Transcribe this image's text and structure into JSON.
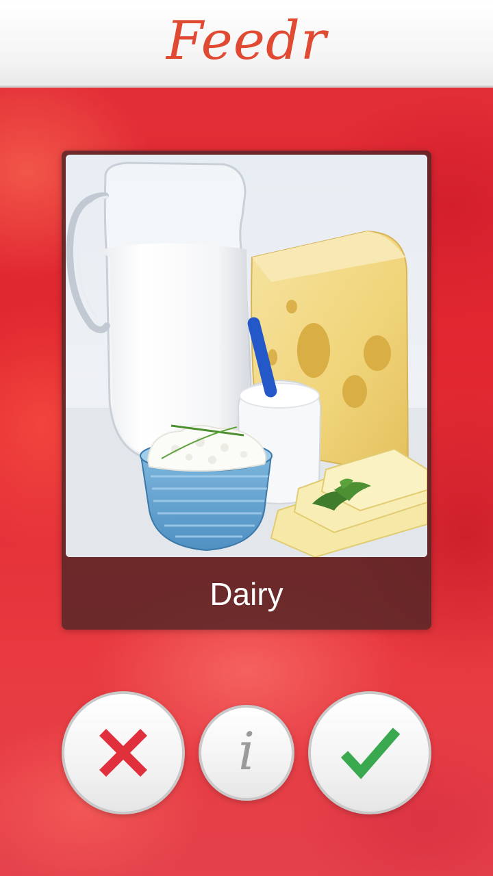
{
  "app": {
    "title": "Feedr",
    "brand_color": "#e04a32",
    "background_color": "#e0262f"
  },
  "card": {
    "title": "Dairy",
    "image_icon": "dairy-photo"
  },
  "actions": {
    "reject": {
      "icon": "close-icon",
      "color": "#e0303c"
    },
    "info": {
      "icon": "info-icon",
      "glyph": "i"
    },
    "accept": {
      "icon": "checkmark-icon",
      "color": "#3aa84f"
    }
  }
}
